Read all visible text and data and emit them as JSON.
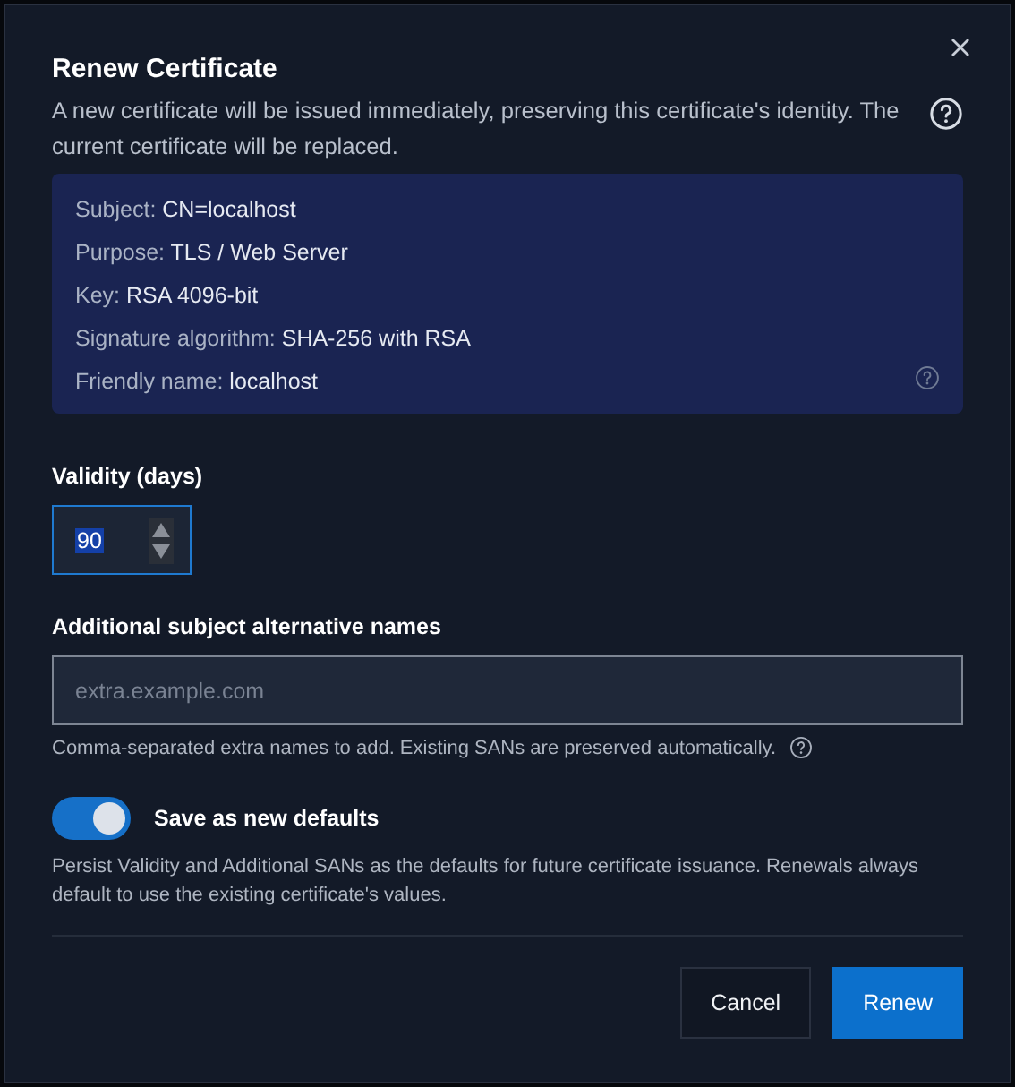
{
  "dialog": {
    "title": "Renew Certificate",
    "description": "A new certificate will be issued immediately, preserving this certificate's identity. The current certificate will be replaced.",
    "details": [
      {
        "label": "Subject:",
        "value": "CN=localhost"
      },
      {
        "label": "Purpose:",
        "value": "TLS / Web Server"
      },
      {
        "label": "Key:",
        "value": "RSA 4096-bit"
      },
      {
        "label": "Signature algorithm:",
        "value": "SHA-256 with RSA"
      },
      {
        "label": "Friendly name:",
        "value": "localhost"
      }
    ],
    "validity": {
      "label": "Validity (days)",
      "value": "90",
      "text_selected": true
    },
    "sans": {
      "label": "Additional subject alternative names",
      "placeholder": "extra.example.com",
      "hint": "Comma-separated extra names to add. Existing SANs are preserved automatically."
    },
    "save_defaults": {
      "label": "Save as new defaults",
      "on": true,
      "description": "Persist Validity and Additional SANs as the defaults for future certificate issuance. Renewals always default to use the existing certificate's values."
    },
    "buttons": [
      {
        "label": "Cancel",
        "kind": "secondary"
      },
      {
        "label": "Renew",
        "kind": "primary"
      }
    ]
  }
}
